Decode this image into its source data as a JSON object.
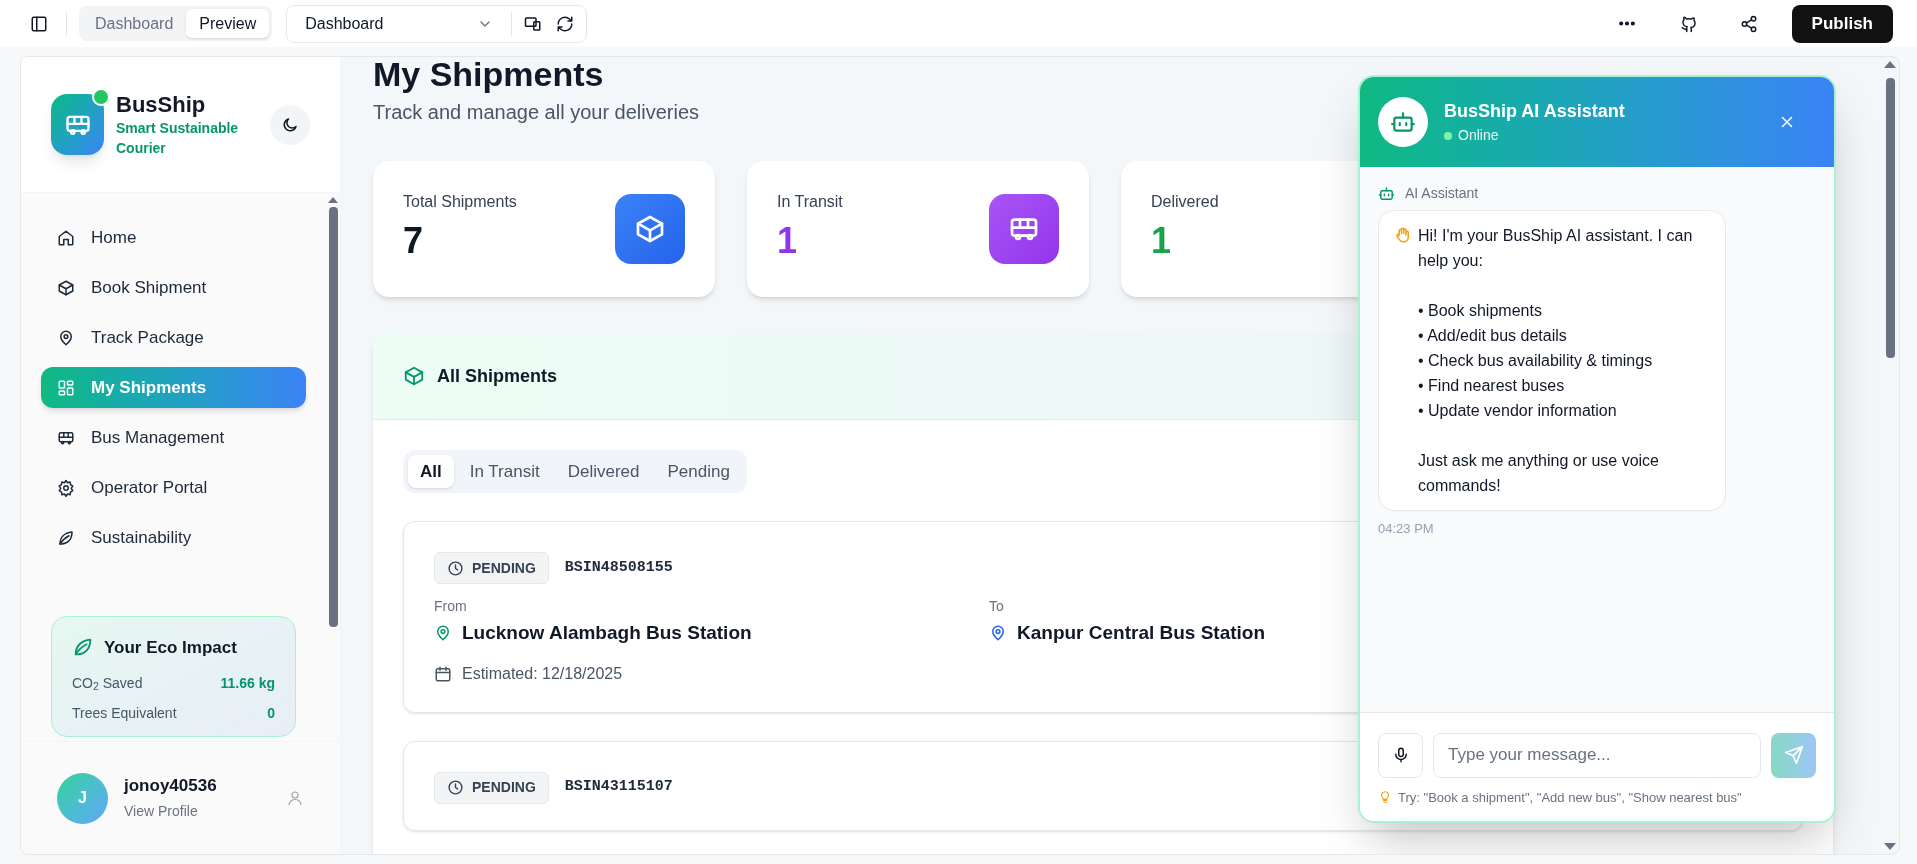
{
  "toolbar": {
    "modes": [
      {
        "label": "Dashboard",
        "selected": false
      },
      {
        "label": "Preview",
        "selected": true
      }
    ],
    "page_select": "Dashboard",
    "publish": "Publish"
  },
  "sidebar": {
    "brand": "BusShip",
    "tagline": "Smart Sustainable Courier",
    "items": [
      {
        "label": "Home",
        "kind": "home",
        "selected": false
      },
      {
        "label": "Book Shipment",
        "kind": "box",
        "selected": false
      },
      {
        "label": "Track Package",
        "kind": "pin",
        "selected": false
      },
      {
        "label": "My Shipments",
        "kind": "grid",
        "selected": true
      },
      {
        "label": "Bus Management",
        "kind": "bus",
        "selected": false
      },
      {
        "label": "Operator Portal",
        "kind": "gear",
        "selected": false
      },
      {
        "label": "Sustainability",
        "kind": "leaf",
        "selected": false
      }
    ],
    "eco": {
      "title": "Your Eco Impact",
      "rows": [
        {
          "label": "CO$_{2}$ Saved",
          "value": "11.66 kg"
        },
        {
          "label": "Trees Equivalent",
          "value": "0"
        }
      ]
    },
    "user": {
      "initial": "J",
      "name": "jonoy40536",
      "link": "View Profile"
    }
  },
  "main": {
    "title": "My Shipments",
    "subtitle": "Track and manage all your deliveries",
    "stats": [
      {
        "label": "Total Shipments",
        "value": "7",
        "kind": "total"
      },
      {
        "label": "In Transit",
        "value": "1",
        "kind": "transit"
      },
      {
        "label": "Delivered",
        "value": "1",
        "kind": "delivered"
      }
    ],
    "section_title": "All Shipments",
    "filters": [
      {
        "label": "All",
        "selected": true
      },
      {
        "label": "In Transit",
        "selected": false
      },
      {
        "label": "Delivered",
        "selected": false
      },
      {
        "label": "Pending",
        "selected": false
      }
    ],
    "shipments": [
      {
        "status": "PENDING",
        "id": "BSIN48508155",
        "from_label": "From",
        "from": "Lucknow Alambagh Bus Station",
        "to_label": "To",
        "to": "Kanpur Central Bus Station",
        "estimated": "Estimated: 12/18/2025"
      },
      {
        "status": "PENDING",
        "id": "BSIN43115107"
      }
    ]
  },
  "chat": {
    "title": "BusShip AI Assistant",
    "status": "Online",
    "sender": "AI Assistant",
    "message": "Hi! I'm your BusShip AI assistant. I can help you:\n\n• Book shipments\n• Add/edit bus details\n• Check bus availability & timings\n• Find nearest buses\n• Update vendor information\n\nJust ask me anything or use voice commands!",
    "time": "04:23 PM",
    "placeholder": "Type your message...",
    "hint": "Try: \"Book a shipment\", \"Add new bus\", \"Show nearest bus\""
  }
}
